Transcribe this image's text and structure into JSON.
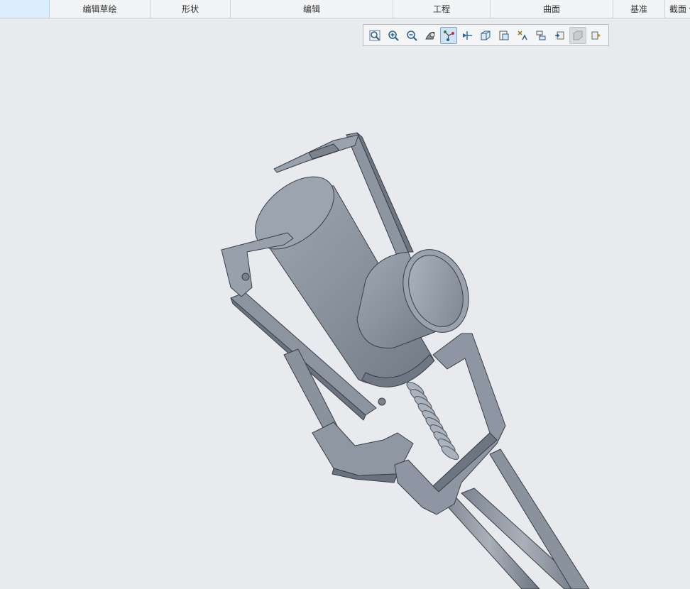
{
  "ribbon": {
    "tabs": [
      {
        "label": ""
      },
      {
        "label": "编辑草绘"
      },
      {
        "label": "形状"
      },
      {
        "label": "编辑"
      },
      {
        "label": "工程"
      },
      {
        "label": "曲面"
      },
      {
        "label": "基准"
      },
      {
        "label": "截面 ▾"
      }
    ]
  },
  "view_toolbar": {
    "buttons": [
      {
        "icon": "zoom-fit-icon"
      },
      {
        "icon": "zoom-in-icon"
      },
      {
        "icon": "zoom-out-icon"
      },
      {
        "icon": "shade-style-icon"
      },
      {
        "icon": "datum-display-icon",
        "state": "active"
      },
      {
        "icon": "spin-center-icon"
      },
      {
        "icon": "view-orientation-icon"
      },
      {
        "icon": "saved-views-icon"
      },
      {
        "icon": "annotation-display-icon"
      },
      {
        "icon": "appearance-icon"
      },
      {
        "icon": "repaint-icon"
      },
      {
        "icon": "section-view-icon",
        "state": "disabled"
      },
      {
        "icon": "perspective-icon"
      }
    ]
  },
  "model": {
    "colors": {
      "body": "#8e96a3",
      "edge": "#3a3f47",
      "highlight": "#b3bac4",
      "shadow": "#6f7784"
    }
  }
}
